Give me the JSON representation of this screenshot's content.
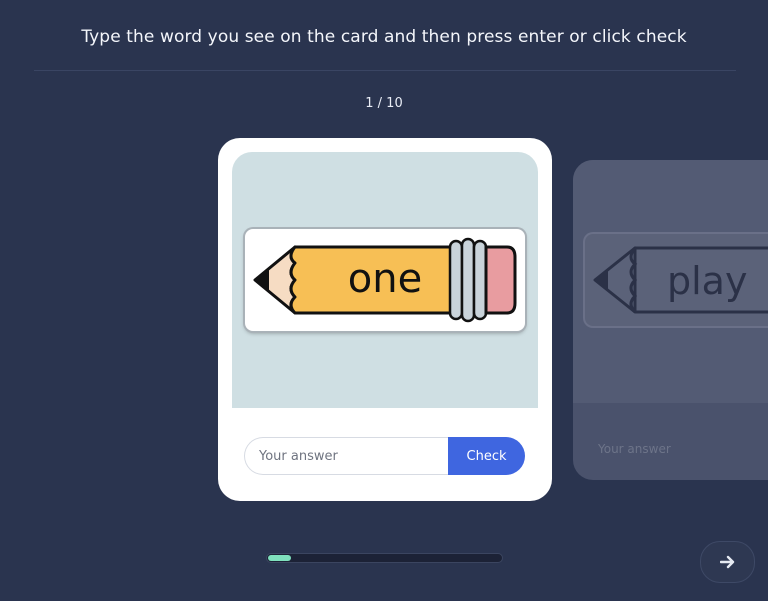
{
  "header": {
    "instruction": "Type the word you see on the card and then press enter or click check"
  },
  "counter": "1 / 10",
  "progress": {
    "current": 1,
    "total": 10
  },
  "current_card": {
    "word": "one",
    "answer_placeholder": "Your answer",
    "check_label": "Check"
  },
  "next_card": {
    "word": "play",
    "answer_placeholder": "Your answer"
  },
  "icons": {
    "next": "arrow-right-icon",
    "word_image": "pencil-icon"
  },
  "colors": {
    "background": "#2a344f",
    "accent": "#3f66e0",
    "progress": "#7fe0bd",
    "pencil_body": "#f7bf55",
    "eraser": "#e89ca0"
  }
}
